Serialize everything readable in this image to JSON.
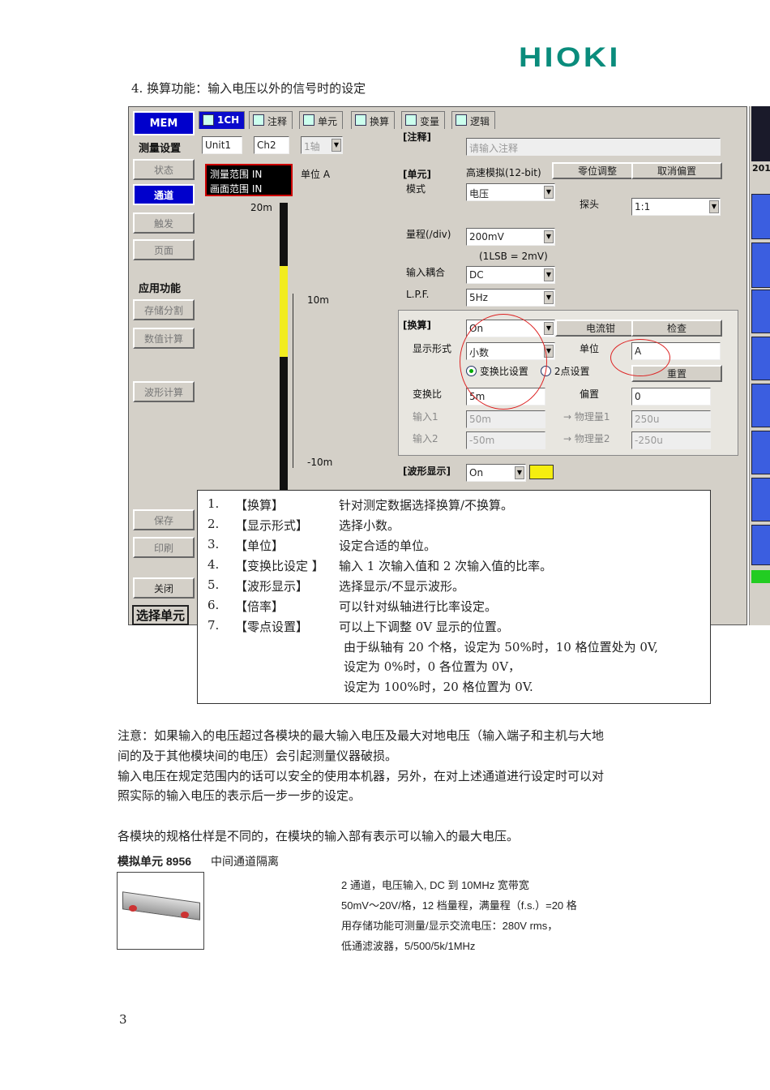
{
  "logo": "HIOKI",
  "heading": "4. 换算功能：输入电压以外的信号时的设定",
  "screen": {
    "sidebar": {
      "mem": "MEM",
      "sec_measure": "测量设置",
      "status": "状态",
      "channel": "通道",
      "trigger": "触发",
      "page": "页面",
      "sec_app": "应用功能",
      "storage_split": "存储分割",
      "numeric_calc": "数值计算",
      "wave_calc": "波形计算",
      "save": "保存",
      "print": "印刷",
      "close": "关闭",
      "select_unit": "选择单元"
    },
    "tabs": [
      "1CH",
      "注释",
      "单元",
      "换算",
      "变量",
      "逻辑"
    ],
    "unit_select": {
      "unit": "Unit1",
      "ch": "Ch2",
      "axis": "1轴"
    },
    "range_box": {
      "line1": "测量范围  IN",
      "line2": "画面范围  IN",
      "unit_label": "单位 A"
    },
    "scale_labels": {
      "top": "20m",
      "mid_upper": "10m",
      "mid_lower": "-10m"
    },
    "comment": {
      "title": "[注释]",
      "placeholder": "请输入注释"
    },
    "unit_section": {
      "title": "[单元]",
      "type": "高速模拟(12-bit)",
      "zero_adjust": "零位调整",
      "cancel_offset": "取消偏置",
      "mode_label": "模式",
      "mode_value": "电压",
      "probe_label": "探头",
      "probe_value": "1:1",
      "range_label": "量程(/div)",
      "range_value": "200mV",
      "lsb": "(1LSB = 2mV)",
      "coupling_label": "输入耦合",
      "coupling_value": "DC",
      "lpf_label": "L.P.F.",
      "lpf_value": "5Hz"
    },
    "conversion": {
      "title": "[换算]",
      "value": "On",
      "clamp": "电流钳",
      "check": "检查",
      "format_label": "显示形式",
      "format_value": "小数",
      "unit_label": "单位",
      "unit_value": "A",
      "radio1": "变换比设置",
      "radio2": "2点设置",
      "reset": "重置",
      "ratio_label": "变换比",
      "ratio_value": "5m",
      "offset_label": "偏置",
      "offset_value": "0",
      "in1_label": "输入1",
      "in1_value": "50m",
      "phys1_label": "→ 物理量1",
      "phys1_value": "250u",
      "in2_label": "输入2",
      "in2_value": "-50m",
      "phys2_label": "→ 物理量2",
      "phys2_value": "-250u"
    },
    "waveform": {
      "title": "[波形显示]",
      "value": "On",
      "color": "#f5ee10"
    },
    "right_strip": {
      "year": "201"
    }
  },
  "info_rows": [
    {
      "num": "1.",
      "name": "【换算】",
      "desc": "针对测定数据选择换算/不换算。"
    },
    {
      "num": "2.",
      "name": "【显示形式】",
      "desc": "选择小数。"
    },
    {
      "num": "3.",
      "name": "【单位】",
      "desc": "设定合适的单位。"
    },
    {
      "num": "4.",
      "name": "【变换比设定 】",
      "desc": "输入 1 次输入值和 2 次输入值的比率。"
    },
    {
      "num": "5.",
      "name": "【波形显示】",
      "desc": "选择显示/不显示波形。"
    },
    {
      "num": "6.",
      "name": "【倍率】",
      "desc": "可以针对纵轴进行比率设定。"
    },
    {
      "num": "7.",
      "name": "【零点设置】",
      "desc": "可以上下调整 0V 显示的位置。"
    }
  ],
  "info_extra": [
    "由于纵轴有 20 个格，设定为 50%时，10 格位置处为 0V,",
    "设定为 0%时，0 各位置为 0V，",
    "设定为 100%时，20 格位置为 0V."
  ],
  "note": [
    "注意：如果输入的电压超过各模块的最大输入电压及最大对地电压（输入端子和主机与大地",
    "间的及于其他模块间的电压）会引起测量仪器破损。",
    "输入电压在规定范围内的话可以安全的使用本机器，另外，在对上述通道进行设定时可以对",
    "照实际的输入电压的表示后一步一步的设定。"
  ],
  "spec_intro": "各模块的规格仕样是不同的，在模块的输入部有表示可以输入的最大电压。",
  "module": {
    "name": "模拟单元 8956",
    "isolation": "中间通道隔离",
    "specs": [
      "2 通道，电压输入, DC  到 10MHz   宽带宽",
      "50mV～20V/格，12 档量程，满量程（f.s.）=20 格",
      "用存储功能可测量/显示交流电压：280V rms，",
      "低通滤波器，5/500/5k/1MHz"
    ]
  },
  "page_number": "3"
}
